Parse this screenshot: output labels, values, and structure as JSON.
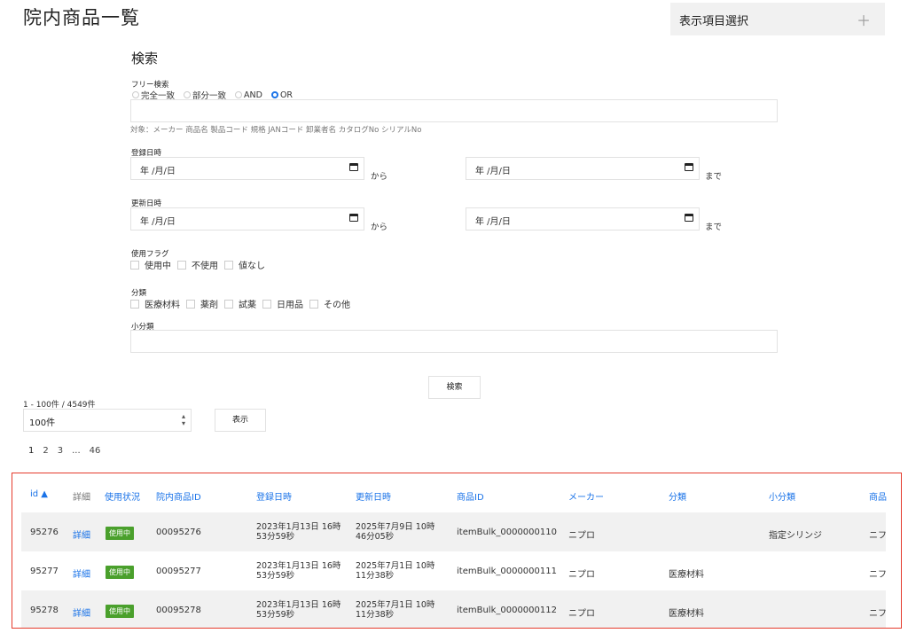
{
  "page": {
    "title": "院内商品一覧"
  },
  "column_select": {
    "label": "表示項目選択",
    "icon": "plus-icon"
  },
  "search": {
    "title": "検索",
    "free_search": {
      "label": "フリー検索",
      "options": [
        "完全一致",
        "部分一致",
        "AND",
        "OR"
      ],
      "selected": "OR",
      "value": "",
      "hint": "対象：メーカー 商品名 製品コード 規格 JANコード 卸業者名 カタログNo シリアルNo"
    },
    "registered": {
      "label": "登録日時",
      "from_placeholder": "年 /月/日",
      "from_suffix": "から",
      "to_placeholder": "年 /月/日",
      "to_suffix": "まで"
    },
    "updated": {
      "label": "更新日時",
      "from_placeholder": "年 /月/日",
      "from_suffix": "から",
      "to_placeholder": "年 /月/日",
      "to_suffix": "まで"
    },
    "use_flag": {
      "label": "使用フラグ",
      "options": [
        "使用中",
        "不使用",
        "値なし"
      ]
    },
    "category": {
      "label": "分類",
      "options": [
        "医療材料",
        "薬剤",
        "試薬",
        "日用品",
        "その他"
      ]
    },
    "subcategory": {
      "label": "小分類",
      "value": ""
    },
    "search_button": "検索"
  },
  "results": {
    "summary": "1 - 100件 / 4549件",
    "per_page": "100件",
    "display_button": "表示",
    "pages": [
      "1",
      "2",
      "3",
      "...",
      "46"
    ],
    "current_page": "1"
  },
  "table": {
    "headers": [
      "id ▲",
      "詳細",
      "使用状況",
      "院内商品ID",
      "登録日時",
      "更新日時",
      "商品ID",
      "メーカー",
      "分類",
      "小分類",
      "商品"
    ],
    "rows": [
      {
        "id": "95276",
        "detail": "詳細",
        "status": "使用中",
        "internal_id": "00095276",
        "created_1": "2023年1月13日 16時",
        "created_2": "53分59秒",
        "updated_1": "2025年7月9日 10時",
        "updated_2": "46分05秒",
        "product_id": "itemBulk_0000000110",
        "maker": "ニプロ",
        "category": "",
        "subcategory": "指定シリンジ",
        "name": "ニフ"
      },
      {
        "id": "95277",
        "detail": "詳細",
        "status": "使用中",
        "internal_id": "00095277",
        "created_1": "2023年1月13日 16時",
        "created_2": "53分59秒",
        "updated_1": "2025年7月1日 10時",
        "updated_2": "11分38秒",
        "product_id": "itemBulk_0000000111",
        "maker": "ニプロ",
        "category": "医療材料",
        "subcategory": "",
        "name": "ニフ"
      },
      {
        "id": "95278",
        "detail": "詳細",
        "status": "使用中",
        "internal_id": "00095278",
        "created_1": "2023年1月13日 16時",
        "created_2": "53分59秒",
        "updated_1": "2025年7月1日 10時",
        "updated_2": "11分38秒",
        "product_id": "itemBulk_0000000112",
        "maker": "ニプロ",
        "category": "医療材料",
        "subcategory": "",
        "name": "ニフ"
      }
    ]
  },
  "colors": {
    "accent": "#1a73e8",
    "status_green": "#4aa02c",
    "highlight_border": "#e53b2c"
  }
}
